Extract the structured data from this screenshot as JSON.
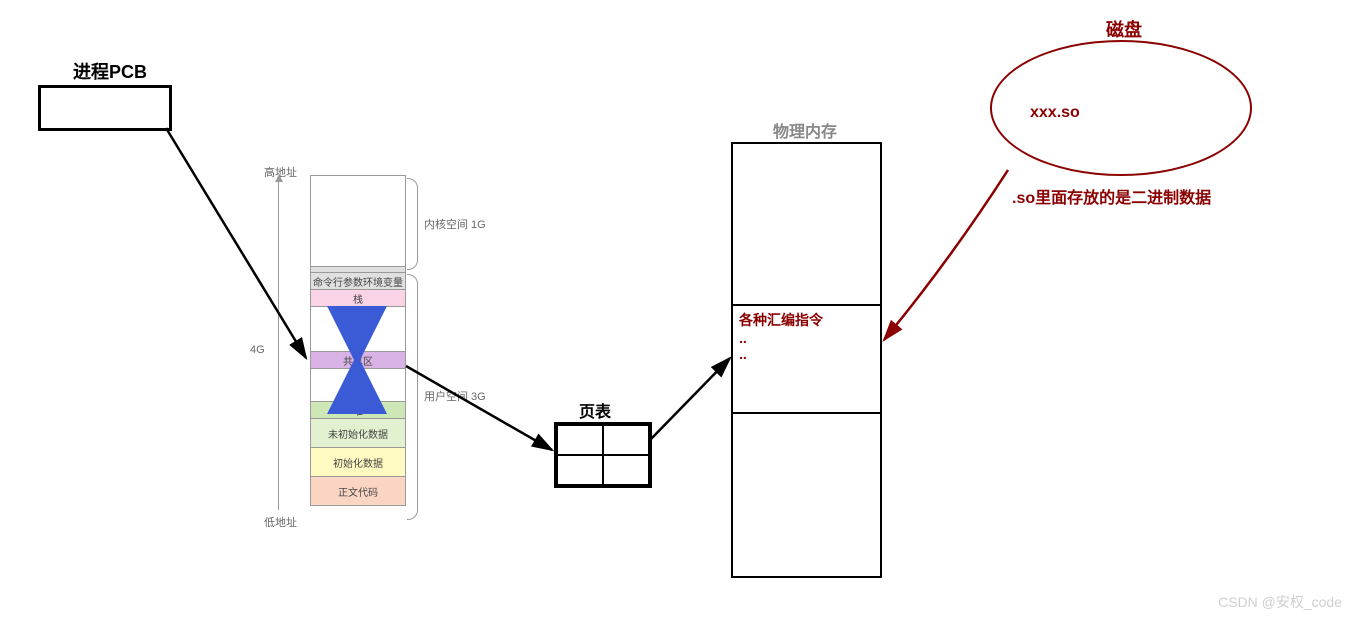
{
  "pcb_title": "进程PCB",
  "addr": {
    "high": "高地址",
    "low": "低地址",
    "total": "4G"
  },
  "mem": {
    "cmd": "命令行参数环境变量",
    "stack": "栈",
    "shared": "共享区",
    "heap": "堆",
    "bss": "未初始化数据",
    "data": "初始化数据",
    "text": "正文代码"
  },
  "brace": {
    "kernel": "内核空间 1G",
    "user": "用户空间 3G"
  },
  "page_table_title": "页表",
  "phys_mem_title": "物理内存",
  "phys_mem_content": {
    "line1": "各种汇编指令",
    "line2": "..",
    "line3": ".."
  },
  "disk": {
    "title": "磁盘",
    "file": "xxx.so",
    "note": ".so里面存放的是二进制数据"
  },
  "watermark": "CSDN @安权_code"
}
